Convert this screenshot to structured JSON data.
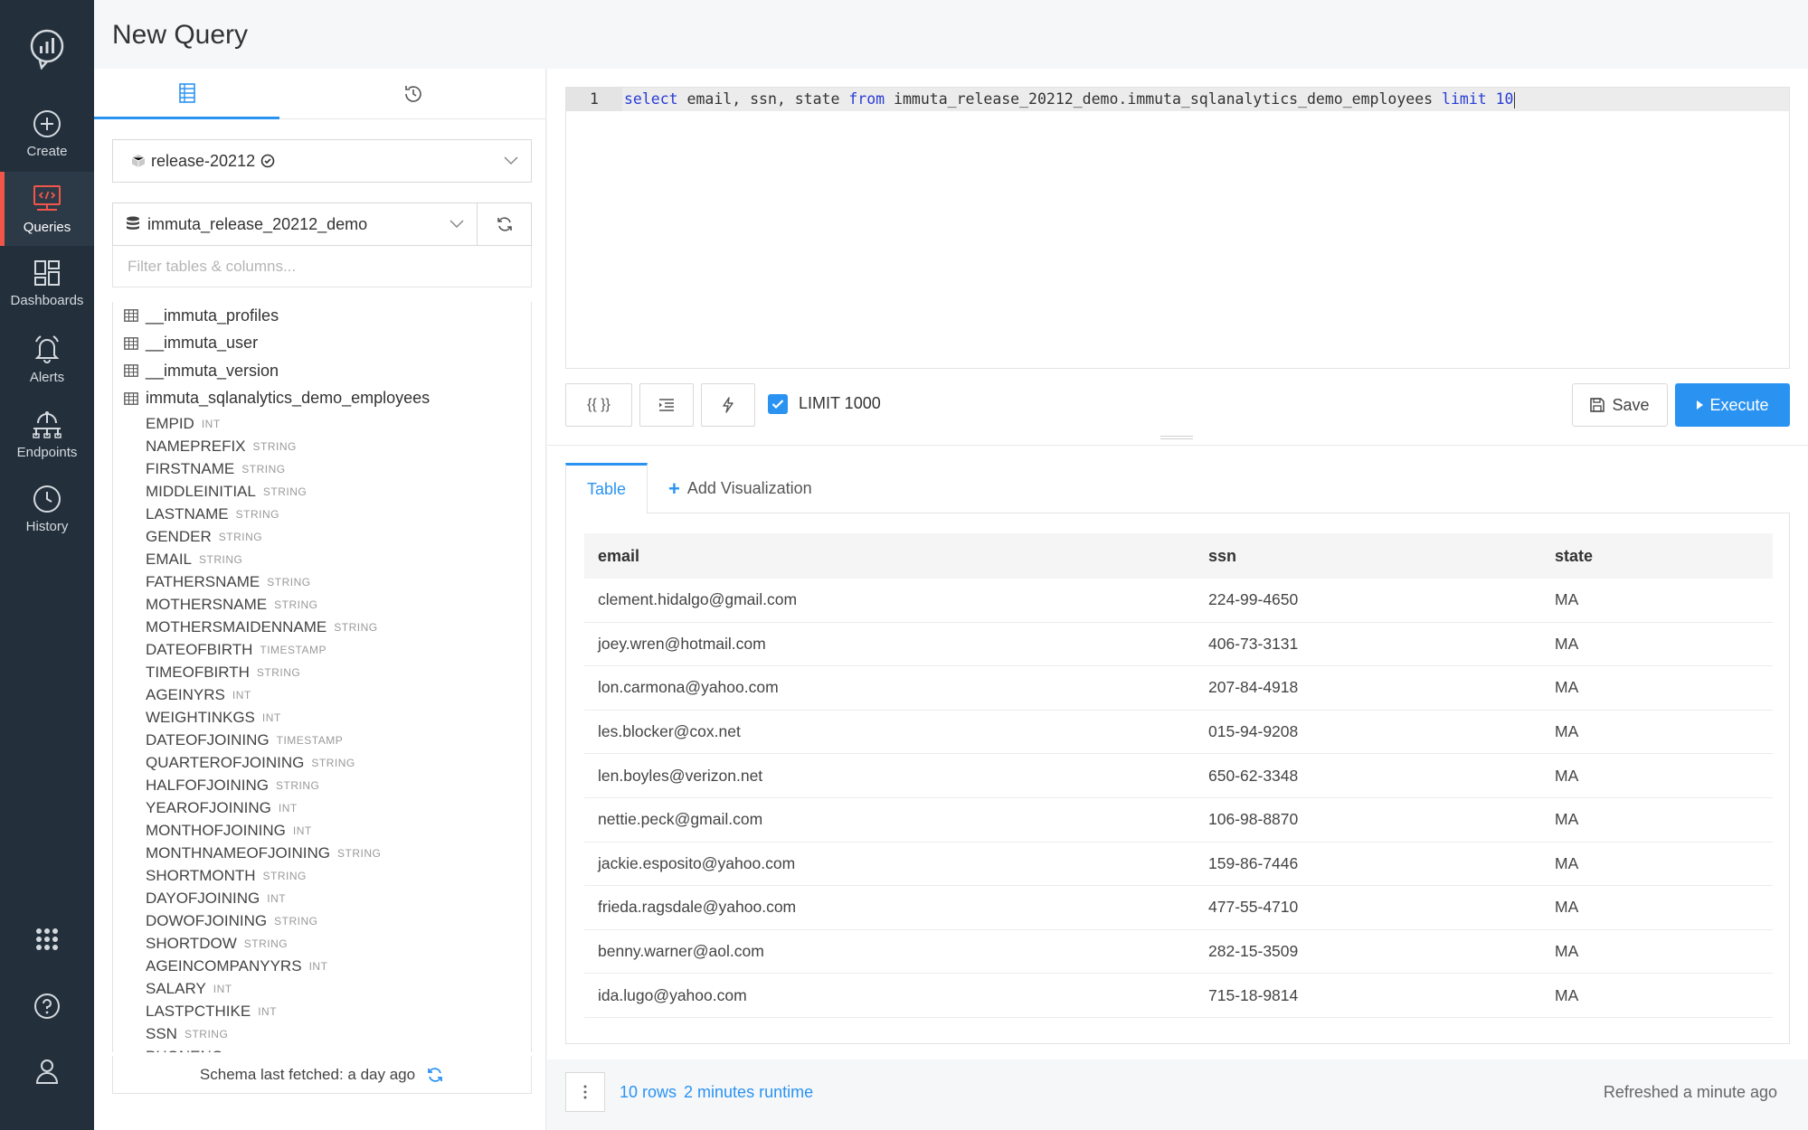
{
  "nav": {
    "items": [
      {
        "label": "Create",
        "icon": "plus-circle-icon"
      },
      {
        "label": "Queries",
        "icon": "code-monitor-icon"
      },
      {
        "label": "Dashboards",
        "icon": "dashboard-grid-icon"
      },
      {
        "label": "Alerts",
        "icon": "bell-icon"
      },
      {
        "label": "Endpoints",
        "icon": "endpoints-icon"
      },
      {
        "label": "History",
        "icon": "clock-icon"
      }
    ],
    "active_index": 1,
    "accent_color": "#f2564a"
  },
  "header": {
    "title": "New Query"
  },
  "schema": {
    "data_source": "release-20212",
    "database": "immuta_release_20212_demo",
    "filter_placeholder": "Filter tables & columns...",
    "tables": [
      "__immuta_profiles",
      "__immuta_user",
      "__immuta_version",
      "immuta_sqlanalytics_demo_employees"
    ],
    "columns": [
      {
        "name": "EMPID",
        "type": "INT"
      },
      {
        "name": "NAMEPREFIX",
        "type": "STRING"
      },
      {
        "name": "FIRSTNAME",
        "type": "STRING"
      },
      {
        "name": "MIDDLEINITIAL",
        "type": "STRING"
      },
      {
        "name": "LASTNAME",
        "type": "STRING"
      },
      {
        "name": "GENDER",
        "type": "STRING"
      },
      {
        "name": "EMAIL",
        "type": "STRING"
      },
      {
        "name": "FATHERSNAME",
        "type": "STRING"
      },
      {
        "name": "MOTHERSNAME",
        "type": "STRING"
      },
      {
        "name": "MOTHERSMAIDENNAME",
        "type": "STRING"
      },
      {
        "name": "DATEOFBIRTH",
        "type": "TIMESTAMP"
      },
      {
        "name": "TIMEOFBIRTH",
        "type": "STRING"
      },
      {
        "name": "AGEINYRS",
        "type": "INT"
      },
      {
        "name": "WEIGHTINKGS",
        "type": "INT"
      },
      {
        "name": "DATEOFJOINING",
        "type": "TIMESTAMP"
      },
      {
        "name": "QUARTEROFJOINING",
        "type": "STRING"
      },
      {
        "name": "HALFOFJOINING",
        "type": "STRING"
      },
      {
        "name": "YEAROFJOINING",
        "type": "INT"
      },
      {
        "name": "MONTHOFJOINING",
        "type": "INT"
      },
      {
        "name": "MONTHNAMEOFJOINING",
        "type": "STRING"
      },
      {
        "name": "SHORTMONTH",
        "type": "STRING"
      },
      {
        "name": "DAYOFJOINING",
        "type": "INT"
      },
      {
        "name": "DOWOFJOINING",
        "type": "STRING"
      },
      {
        "name": "SHORTDOW",
        "type": "STRING"
      },
      {
        "name": "AGEINCOMPANYYRS",
        "type": "INT"
      },
      {
        "name": "SALARY",
        "type": "INT"
      },
      {
        "name": "LASTPCTHIKE",
        "type": "INT"
      },
      {
        "name": "SSN",
        "type": "STRING"
      },
      {
        "name": "PHONENO",
        "type": "STRING"
      }
    ],
    "footer": "Schema last fetched: a day ago"
  },
  "editor": {
    "line_number": "1",
    "tokens": [
      {
        "t": "select",
        "kw": true
      },
      {
        "t": " email, ssn, state ",
        "kw": false
      },
      {
        "t": "from",
        "kw": true
      },
      {
        "t": " immuta_release_20212_demo.immuta_sqlanalytics_demo_employees ",
        "kw": false
      },
      {
        "t": "limit",
        "kw": true
      },
      {
        "t": " ",
        "kw": false
      },
      {
        "t": "10",
        "kw": true
      }
    ]
  },
  "toolbar": {
    "params_label": "{{ }}",
    "limit_label": "LIMIT 1000",
    "limit_checked": true,
    "save_label": "Save",
    "execute_label": "Execute",
    "primary_color": "#2a93f2"
  },
  "results": {
    "tab_label": "Table",
    "add_vis_label": "Add Visualization",
    "columns": [
      "email",
      "ssn",
      "state"
    ],
    "rows": [
      [
        "clement.hidalgo@gmail.com",
        "224-99-4650",
        "MA"
      ],
      [
        "joey.wren@hotmail.com",
        "406-73-3131",
        "MA"
      ],
      [
        "lon.carmona@yahoo.com",
        "207-84-4918",
        "MA"
      ],
      [
        "les.blocker@cox.net",
        "015-94-9208",
        "MA"
      ],
      [
        "len.boyles@verizon.net",
        "650-62-3348",
        "MA"
      ],
      [
        "nettie.peck@gmail.com",
        "106-98-8870",
        "MA"
      ],
      [
        "jackie.esposito@yahoo.com",
        "159-86-7446",
        "MA"
      ],
      [
        "frieda.ragsdale@yahoo.com",
        "477-55-4710",
        "MA"
      ],
      [
        "benny.warner@aol.com",
        "282-15-3509",
        "MA"
      ],
      [
        "ida.lugo@yahoo.com",
        "715-18-9814",
        "MA"
      ]
    ]
  },
  "footer": {
    "rows_text": "10 rows",
    "runtime_text": "2 minutes runtime",
    "refreshed_text": "Refreshed a minute ago"
  }
}
